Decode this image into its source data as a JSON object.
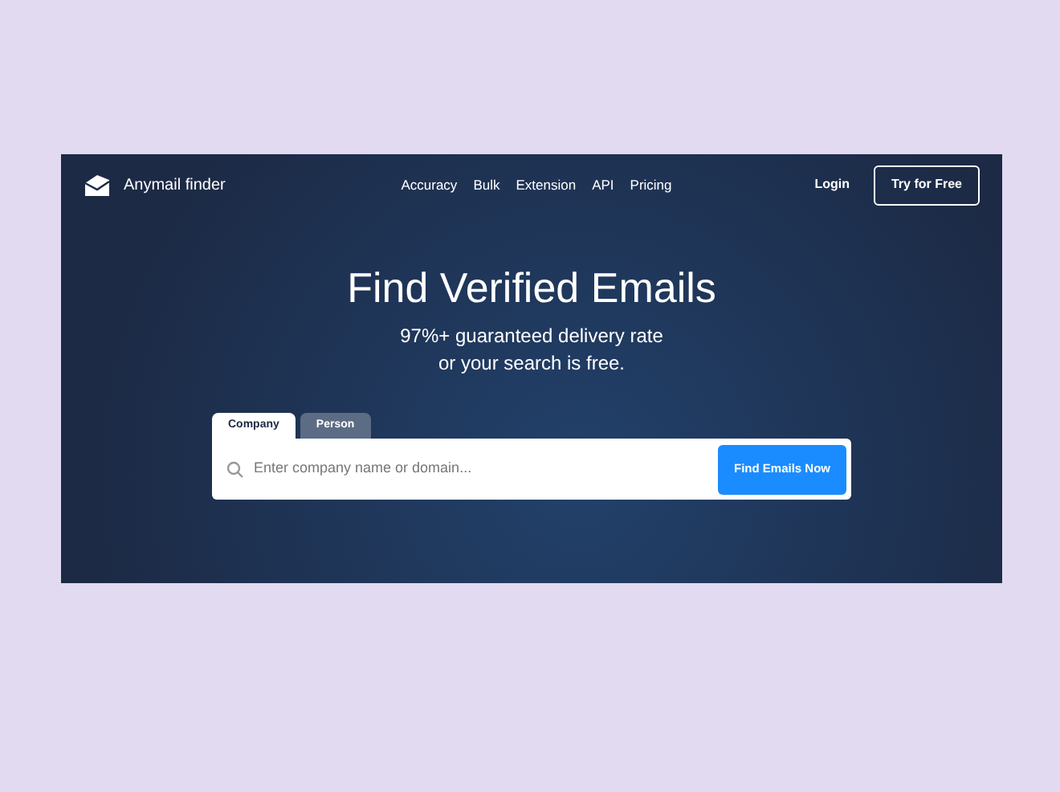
{
  "brand": "Anymail finder",
  "nav": [
    "Accuracy",
    "Bulk",
    "Extension",
    "API",
    "Pricing"
  ],
  "login": "Login",
  "cta": "Try for Free",
  "headline": "Find Verified Emails",
  "subtitle_lines": [
    "97%+ guaranteed delivery rate",
    "or your search is free."
  ],
  "tabs": [
    {
      "label": "Company",
      "selected": true
    },
    {
      "label": "Person",
      "selected": false
    }
  ],
  "search": {
    "placeholder": "Enter company name or domain...",
    "button": "Find Emails Now"
  }
}
